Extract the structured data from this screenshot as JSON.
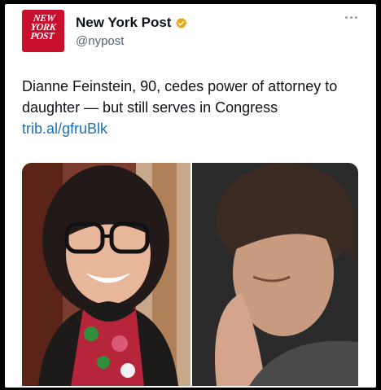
{
  "author": {
    "name": "New York Post",
    "handle": "@nypost",
    "avatar_text": [
      "NEW",
      "YORK",
      "POST"
    ],
    "verified": true,
    "avatar_color": "#c8102e",
    "badge_color": "#e6a817"
  },
  "tweet": {
    "text": "Dianne Feinstein, 90, cedes power of attorney to daughter — but still serves in Congress",
    "link": "trib.al/gfruBlk"
  },
  "colors": {
    "link": "#1d6fb8",
    "text": "#0f1419",
    "secondary": "#536471"
  }
}
